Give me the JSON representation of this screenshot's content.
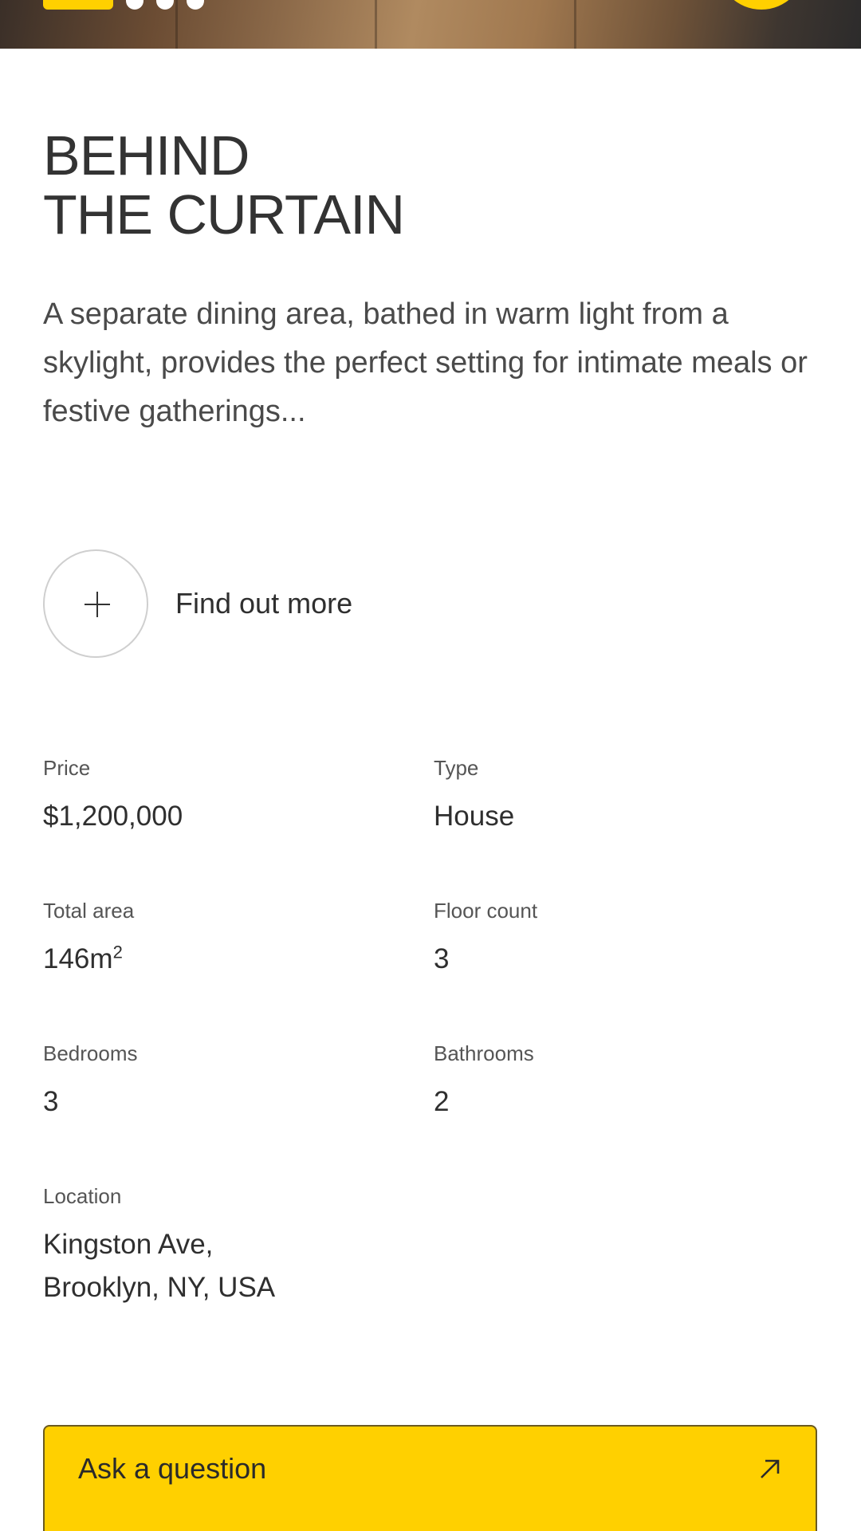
{
  "hero": {
    "pager": {
      "active_index": 0,
      "count": 4
    },
    "fab_color": "#ffd000"
  },
  "title": {
    "line1": "BEHIND",
    "line2": "THE CURTAIN"
  },
  "description": "A separate dining area, bathed in warm light from a skylight, provides the perfect setting for intimate meals or festive gatherings...",
  "find_more": {
    "icon": "plus-icon",
    "label": "Find out more"
  },
  "specs": {
    "price": {
      "label": "Price",
      "value": "$1,200,000"
    },
    "type": {
      "label": "Type",
      "value": "House"
    },
    "total_area": {
      "label": "Total area",
      "value": "146m",
      "unit_superscript": "2"
    },
    "floor_count": {
      "label": "Floor count",
      "value": "3"
    },
    "bedrooms": {
      "label": "Bedrooms",
      "value": "3"
    },
    "bathrooms": {
      "label": "Bathrooms",
      "value": "2"
    },
    "location": {
      "label": "Location",
      "line1": "Kingston Ave,",
      "line2": "Brooklyn, NY, USA"
    }
  },
  "cta": {
    "label": "Ask a question",
    "icon": "arrow-up-right-icon",
    "color": "#ffd000"
  }
}
